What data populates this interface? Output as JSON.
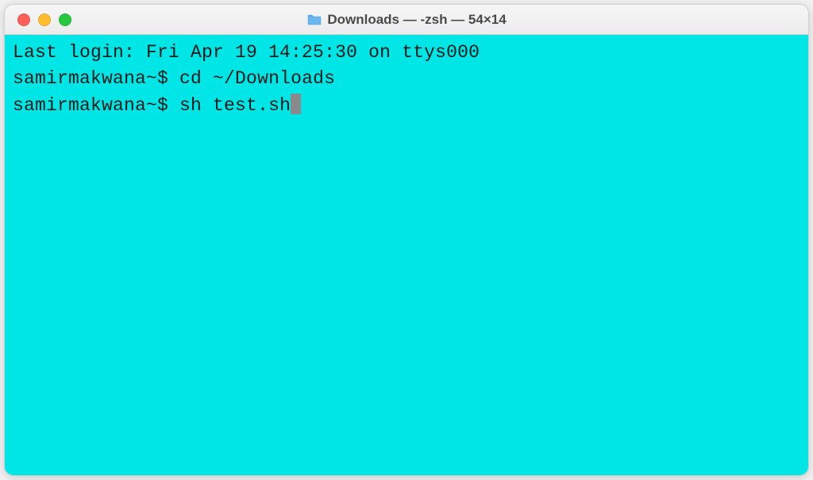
{
  "window": {
    "title": "Downloads — -zsh — 54×14"
  },
  "terminal": {
    "last_login": "Last login: Fri Apr 19 14:25:30 on ttys000",
    "lines": [
      {
        "prompt": "samirmakwana~$ ",
        "command": "cd ~/Downloads"
      },
      {
        "prompt": "samirmakwana~$ ",
        "command": "sh test.sh"
      }
    ]
  }
}
